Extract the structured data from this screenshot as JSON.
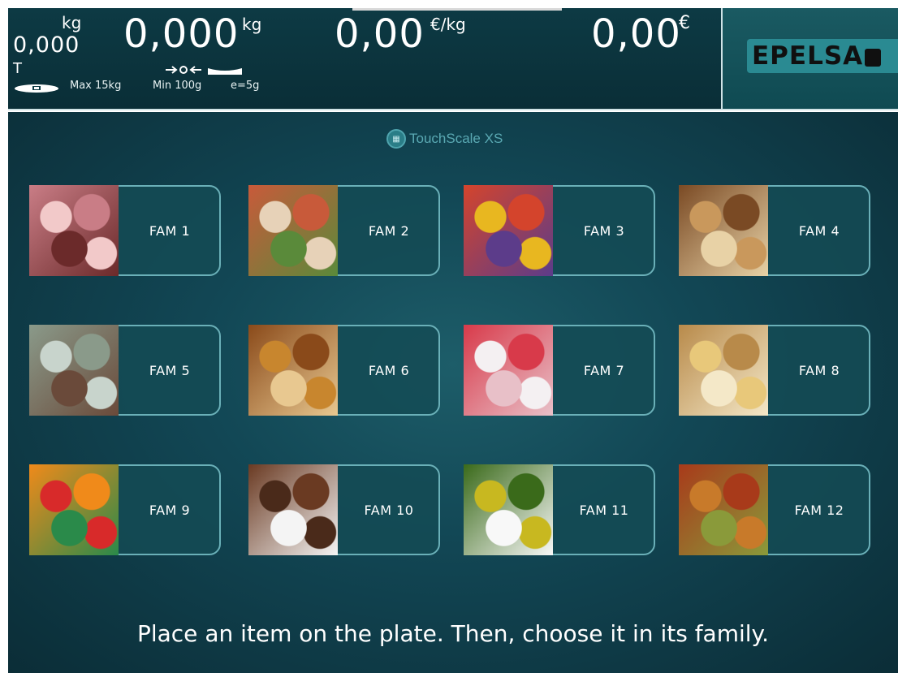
{
  "display": {
    "tare": {
      "unit": "kg",
      "value": "0,000",
      "label": "T"
    },
    "weight": {
      "value": "0,000",
      "unit": "kg"
    },
    "price": {
      "value": "0,00",
      "unit": "€/kg"
    },
    "total": {
      "value": "0,00",
      "unit": "€"
    },
    "meta": {
      "max": "Max 15kg",
      "min": "Min 100g",
      "e": "e=5g"
    },
    "logo": "EPELSA"
  },
  "brand": "TouchScale XS",
  "families": [
    {
      "label": "FAM 1",
      "image": "meat",
      "colors": [
        "#f2c9c9",
        "#c97d86",
        "#6b2a2a"
      ]
    },
    {
      "label": "FAM 2",
      "image": "salad-plates",
      "colors": [
        "#e7d2b8",
        "#c85a3a",
        "#5a8a3a"
      ]
    },
    {
      "label": "FAM 3",
      "image": "fruits",
      "colors": [
        "#e8b720",
        "#d4442c",
        "#5c3c8a"
      ]
    },
    {
      "label": "FAM 4",
      "image": "nuts",
      "colors": [
        "#c9985c",
        "#7a4a24",
        "#e8d2a6"
      ]
    },
    {
      "label": "FAM 5",
      "image": "fish",
      "colors": [
        "#c8d4cc",
        "#8a9a8a",
        "#6a4a3a"
      ]
    },
    {
      "label": "FAM 6",
      "image": "bread",
      "colors": [
        "#c8862e",
        "#8a4a1a",
        "#e8c890"
      ]
    },
    {
      "label": "FAM 7",
      "image": "dessert",
      "colors": [
        "#f4f0f2",
        "#d83a4a",
        "#e8c0c8"
      ]
    },
    {
      "label": "FAM 8",
      "image": "cheese",
      "colors": [
        "#e8c87a",
        "#b88a4a",
        "#f4e8c8"
      ]
    },
    {
      "label": "FAM 9",
      "image": "soft-drinks",
      "colors": [
        "#d82a2a",
        "#f08a1a",
        "#2a8a4a"
      ]
    },
    {
      "label": "FAM 10",
      "image": "chocolate",
      "colors": [
        "#4a2a1a",
        "#6a3a22",
        "#f4f4f4"
      ]
    },
    {
      "label": "FAM 11",
      "image": "oil-bottles",
      "colors": [
        "#c8b820",
        "#3a6a1a",
        "#f8f8f8"
      ]
    },
    {
      "label": "FAM 12",
      "image": "spices",
      "colors": [
        "#c87a2a",
        "#a83a1a",
        "#8a9a3a"
      ]
    }
  ],
  "instruction": "Place an item on the plate. Then, choose it in its family."
}
